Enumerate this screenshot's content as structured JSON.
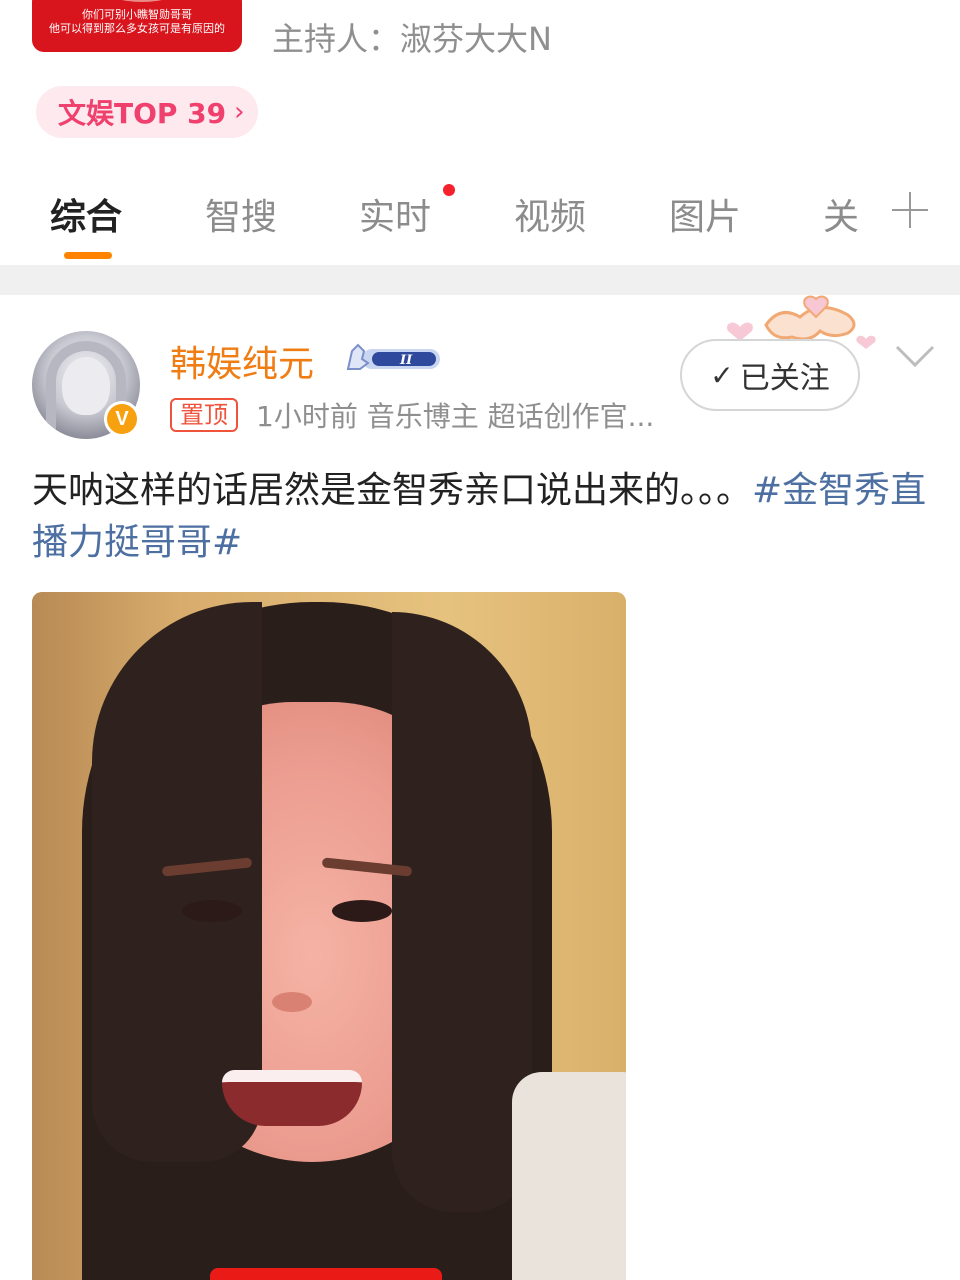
{
  "topic": {
    "cover_lines": [
      "你们可别小瞧智勋哥哥",
      "他可以得到那么多女孩可是有原因的"
    ],
    "host_text": "主持人：淑芬大大N",
    "rank_badge": "文娱TOP 39",
    "rank_badge_chevron": "›"
  },
  "tabs": [
    {
      "label": "综合",
      "active": true
    },
    {
      "label": "智搜",
      "active": false
    },
    {
      "label": "实时",
      "active": false,
      "has_dot": true
    },
    {
      "label": "视频",
      "active": false
    },
    {
      "label": "图片",
      "active": false
    },
    {
      "label": "关",
      "active": false
    }
  ],
  "post": {
    "username": "韩娱纯元",
    "follow_label": "已关注",
    "follow_check": "✓",
    "verified_mark": "V",
    "pinned_tag": "置顶",
    "meta": "1小时前   音乐博主 超话创作官...",
    "text": "天呐这样的话居然是金智秀亲口说出来的。。。",
    "hashtag": "#金智秀直播力挺哥哥#"
  },
  "colors": {
    "accent_orange": "#ff8200",
    "username_orange": "#f07c14",
    "badge_pink": "#f0406d",
    "hashtag_blue": "#4d6fa1",
    "dot_red": "#f5222d"
  },
  "icons": [
    "plus-icon",
    "chevron-down-icon",
    "check-icon",
    "verified-icon",
    "member-level-icon",
    "decorative-hearts-icon"
  ]
}
